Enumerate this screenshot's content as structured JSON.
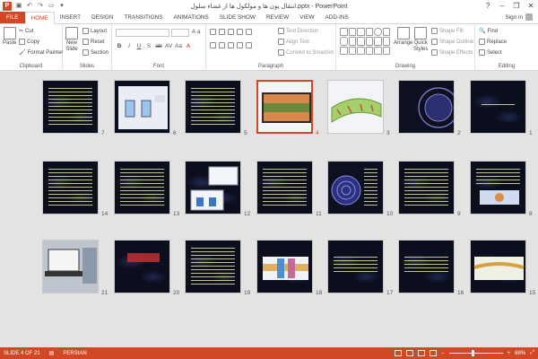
{
  "window": {
    "title": "انتقال یون ها و مولکول ها از غشاء سلول.pptx - PowerPoint",
    "app_letter": "P",
    "controls": [
      "?",
      "–",
      "❐",
      "✕"
    ]
  },
  "tabs": [
    {
      "label": "FILE"
    },
    {
      "label": "HOME"
    },
    {
      "label": "INSERT"
    },
    {
      "label": "DESIGN"
    },
    {
      "label": "TRANSITIONS"
    },
    {
      "label": "ANIMATIONS"
    },
    {
      "label": "SLIDE SHOW"
    },
    {
      "label": "REVIEW"
    },
    {
      "label": "VIEW"
    },
    {
      "label": "ADD-INS"
    }
  ],
  "active_tab": "HOME",
  "signin": "Sign in",
  "ribbon": {
    "clipboard": {
      "label": "Clipboard",
      "paste": "Paste",
      "cut": "Cut",
      "copy": "Copy",
      "format_painter": "Format Painter"
    },
    "slides": {
      "label": "Slides",
      "new_slide": "New",
      "new_slide_2": "Slide",
      "layout": "Layout",
      "reset": "Reset",
      "section": "Section"
    },
    "font": {
      "label": "Font",
      "format_glyphs": [
        "B",
        "I",
        "U",
        "S",
        "ab",
        "AV",
        "Aa",
        "A"
      ]
    },
    "paragraph": {
      "label": "Paragraph",
      "text_direction": "Text Direction",
      "align_text": "Align Text",
      "convert_smartart": "Convert to SmartArt"
    },
    "drawing": {
      "label": "Drawing",
      "arrange": "Arrange",
      "quick_styles": "Quick",
      "quick_styles_2": "Styles",
      "shape_fill": "Shape Fill",
      "shape_outline": "Shape Outline",
      "shape_effects": "Shape Effects"
    },
    "editing": {
      "label": "Editing",
      "find": "Find",
      "replace": "Replace",
      "select": "Select"
    }
  },
  "slides": [
    {
      "num": "1",
      "style": "text-title"
    },
    {
      "num": "2",
      "style": "circles"
    },
    {
      "num": "3",
      "style": "membrane-light"
    },
    {
      "num": "4",
      "style": "membrane-photo",
      "selected": true
    },
    {
      "num": "5",
      "style": "text"
    },
    {
      "num": "6",
      "style": "beakers"
    },
    {
      "num": "7",
      "style": "text"
    },
    {
      "num": "8",
      "style": "text-figure"
    },
    {
      "num": "9",
      "style": "text"
    },
    {
      "num": "10",
      "style": "circles-target"
    },
    {
      "num": "11",
      "style": "text"
    },
    {
      "num": "12",
      "style": "diagrams"
    },
    {
      "num": "13",
      "style": "text"
    },
    {
      "num": "14",
      "style": "text"
    },
    {
      "num": "15",
      "style": "text-figure"
    },
    {
      "num": "16",
      "style": "text"
    },
    {
      "num": "17",
      "style": "text"
    },
    {
      "num": "18",
      "style": "channel"
    },
    {
      "num": "19",
      "style": "text"
    },
    {
      "num": "20",
      "style": "title-red"
    },
    {
      "num": "21",
      "style": "laptop"
    }
  ],
  "status": {
    "slide_of": "SLIDE 4 OF 21",
    "language": "PERSIAN",
    "zoom": "68%",
    "zoom_fraction": 0.45
  }
}
